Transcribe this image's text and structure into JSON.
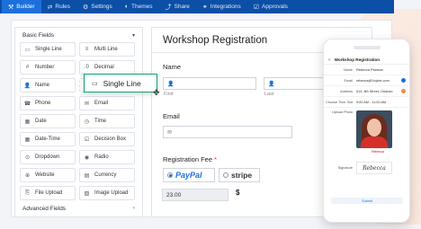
{
  "nav": [
    {
      "label": "Builder",
      "icon": "builder-icon",
      "active": true
    },
    {
      "label": "Rules",
      "icon": "rules-icon"
    },
    {
      "label": "Settings",
      "icon": "gear-icon"
    },
    {
      "label": "Themes",
      "icon": "palette-icon"
    },
    {
      "label": "Share",
      "icon": "share-icon"
    },
    {
      "label": "Integrations",
      "icon": "integrations-icon"
    },
    {
      "label": "Approvals",
      "icon": "approvals-icon"
    }
  ],
  "palette": {
    "title": "Basic Fields",
    "advanced": "Advanced Fields",
    "fields": [
      {
        "label": "Single Line",
        "icon": "single-line-icon"
      },
      {
        "label": "Multi Line",
        "icon": "multi-line-icon"
      },
      {
        "label": "Number",
        "icon": "number-icon"
      },
      {
        "label": "Decimal",
        "icon": "decimal-icon"
      },
      {
        "label": "Name",
        "icon": "name-icon"
      },
      {
        "label": "",
        "icon": ""
      },
      {
        "label": "Phone",
        "icon": "phone-icon"
      },
      {
        "label": "Email",
        "icon": "email-icon"
      },
      {
        "label": "Date",
        "icon": "date-icon"
      },
      {
        "label": "Time",
        "icon": "time-icon"
      },
      {
        "label": "Date-Time",
        "icon": "date-time-icon"
      },
      {
        "label": "Decision Box",
        "icon": "checkbox-icon"
      },
      {
        "label": "Dropdown",
        "icon": "dropdown-icon"
      },
      {
        "label": "Radio",
        "icon": "radio-icon"
      },
      {
        "label": "Website",
        "icon": "globe-icon"
      },
      {
        "label": "Currency",
        "icon": "currency-icon"
      },
      {
        "label": "File Upload",
        "icon": "file-upload-icon"
      },
      {
        "label": "Image Upload",
        "icon": "image-upload-icon"
      }
    ],
    "dragging": "Single Line"
  },
  "form": {
    "title": "Workshop Registration",
    "name_label": "Name",
    "first": "First",
    "last": "Last",
    "email_label": "Email",
    "fee_label": "Registration Fee",
    "required_mark": "*",
    "paypal": "PayPal",
    "stripe": "stripe",
    "amount": "23.00",
    "currency": "$"
  },
  "phone": {
    "back": "<",
    "title": "Workshop Registration",
    "rows": [
      {
        "k": "Name",
        "v": "Rebecca Pearson"
      },
      {
        "k": "Email",
        "v": "rebecca@1cyber.com"
      },
      {
        "k": "Address",
        "v": "514, 8th Street, Orlando"
      },
      {
        "k": "Choose Time Slot",
        "v": "9:00 AM - 11:00 AM"
      }
    ],
    "photo_label": "Upload Photo",
    "photo_name": "Rebecca",
    "signature_label": "Signature",
    "signature": "Rebecca",
    "submit": "Submit"
  },
  "colors": {
    "nav_bg": "#0b4fa6",
    "nav_active": "#1d6fdc",
    "accent": "#1d6fdc",
    "drag_border": "#0ea36d"
  }
}
